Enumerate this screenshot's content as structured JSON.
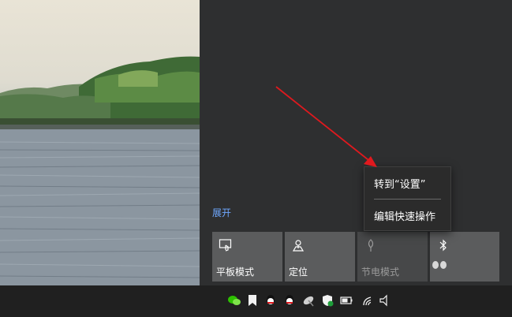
{
  "action_center": {
    "expand_label": "展开",
    "tiles": [
      {
        "label": "平板模式",
        "icon": "tablet-mode-icon",
        "state": "off"
      },
      {
        "label": "定位",
        "icon": "location-icon",
        "state": "off"
      },
      {
        "label": "节电模式",
        "icon": "battery-saver-icon",
        "state": "disabled"
      },
      {
        "label": "",
        "icon": "bluetooth-icon",
        "state": "off"
      }
    ]
  },
  "context_menu": {
    "items": [
      {
        "label": "转到“设置”"
      },
      {
        "label": "编辑快速操作"
      }
    ]
  },
  "taskbar": {
    "tray_icons": [
      "wechat-icon",
      "bookmark-icon",
      "qq-icon",
      "qq-icon",
      "satellite-icon",
      "security-shield-icon",
      "battery-icon",
      "wifi-icon",
      "volume-icon"
    ]
  },
  "colors": {
    "accent_link": "#6fa8ff",
    "annotation_arrow": "#e0191e",
    "panel_background": "#2e2f30",
    "tile_background": "#5b5c5d"
  }
}
